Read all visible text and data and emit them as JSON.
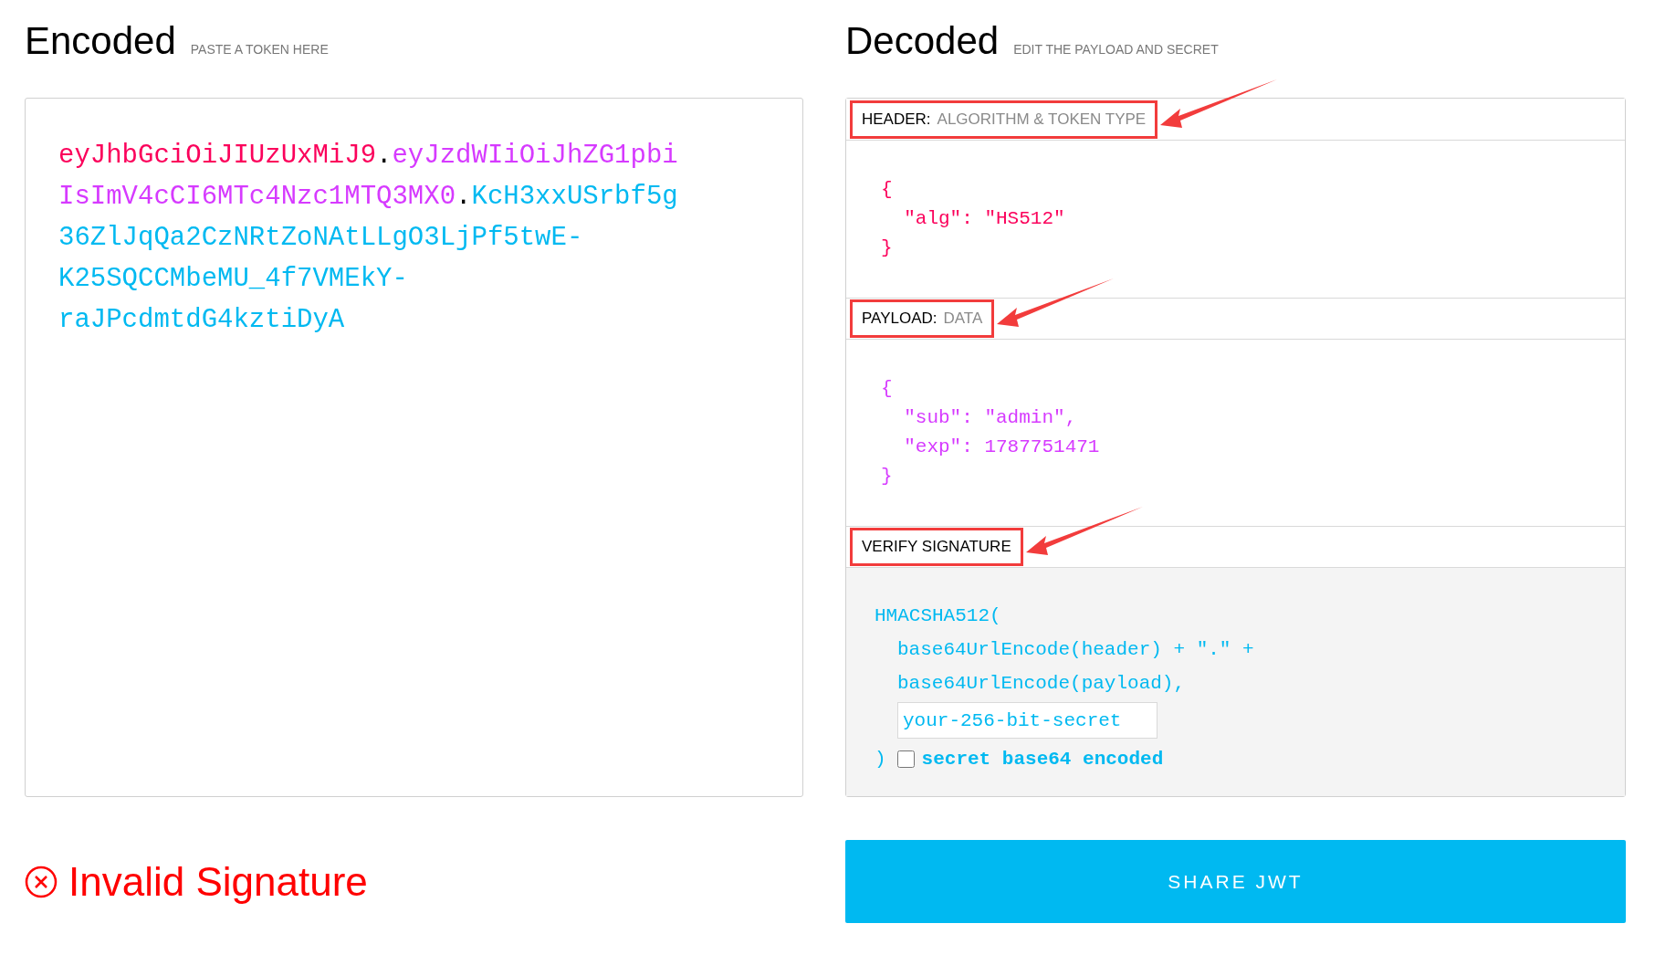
{
  "encoded": {
    "title": "Encoded",
    "subtitle": "PASTE A TOKEN HERE",
    "lines": [
      [
        {
          "text": "eyJhbGciOiJIUzUxMiJ9",
          "kind": "header"
        },
        {
          "text": ".",
          "kind": "dot"
        },
        {
          "text": "eyJzdWIiOiJhZG1pbi",
          "kind": "payload"
        }
      ],
      [
        {
          "text": "IsImV4cCI6MTc4Nzc1MTQ3MX0",
          "kind": "payload"
        },
        {
          "text": ".",
          "kind": "dot"
        },
        {
          "text": "KcH3xxUSrbf5g",
          "kind": "signature"
        }
      ],
      [
        {
          "text": "36ZlJqQa2CzNRtZoNAtLLgO3LjPf5twE-",
          "kind": "signature"
        }
      ],
      [
        {
          "text": "K25SQCCMbeMU_4f7VMEkY-",
          "kind": "signature"
        }
      ],
      [
        {
          "text": "raJPcdmtdG4kztiDyA",
          "kind": "signature"
        }
      ]
    ]
  },
  "decoded": {
    "title": "Decoded",
    "subtitle": "EDIT THE PAYLOAD AND SECRET",
    "sections": [
      {
        "kind": "json",
        "label": "HEADER:",
        "sublabel": "ALGORITHM & TOKEN TYPE",
        "highlighted": true,
        "lines": [
          "{",
          "  \"alg\": \"HS512\"",
          "}"
        ]
      },
      {
        "kind": "json",
        "label": "PAYLOAD:",
        "sublabel": "DATA",
        "highlighted": true,
        "lines": [
          "{",
          "  \"sub\": \"admin\",",
          "  \"exp\": 1787751471",
          "}"
        ]
      },
      {
        "kind": "signature",
        "label": "VERIFY SIGNATURE",
        "highlighted": true,
        "open": "HMACSHA512(",
        "args": [
          "base64UrlEncode(header) + \".\" +",
          "base64UrlEncode(payload),"
        ],
        "secret": {
          "placeholder": "your-256-bit-secret"
        },
        "close": ")",
        "checkbox": {
          "label": "secret base64 encoded",
          "checked": false
        }
      }
    ]
  },
  "status": {
    "text": "Invalid Signature",
    "valid": false
  },
  "share_button": "SHARE JWT"
}
